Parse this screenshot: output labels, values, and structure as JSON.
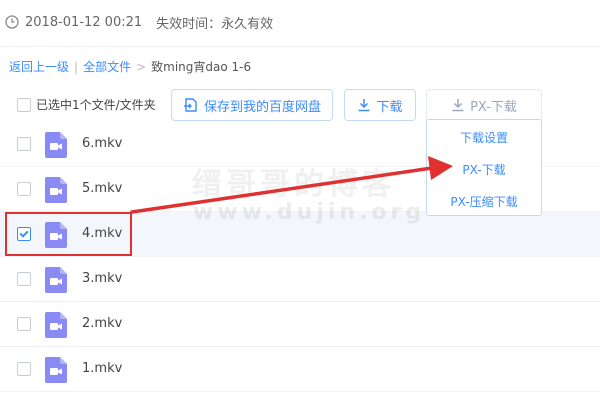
{
  "info": {
    "date": "2018-01-12 00:21",
    "expire_label": "失效时间：永久有效"
  },
  "breadcrumb": {
    "back": "返回上一级",
    "sep1": "|",
    "all_files": "全部文件",
    "sep2": ">",
    "current": "致ming宵dao 1-6"
  },
  "toolbar": {
    "selected_text": "已选中1个文件/文件夹",
    "save_label": "保存到我的百度网盘",
    "download_label": "下载",
    "px_label": "PX-下载"
  },
  "dropdown": {
    "items": [
      "下载设置",
      "PX-下载",
      "PX-压缩下载"
    ]
  },
  "files": [
    {
      "name": "6.mkv",
      "checked": false
    },
    {
      "name": "5.mkv",
      "checked": false
    },
    {
      "name": "4.mkv",
      "checked": true
    },
    {
      "name": "3.mkv",
      "checked": false
    },
    {
      "name": "2.mkv",
      "checked": false
    },
    {
      "name": "1.mkv",
      "checked": false
    }
  ],
  "watermark": {
    "title": "缙哥哥的博客",
    "url": "www.dujin.org"
  },
  "colors": {
    "accent": "#3b8cff",
    "file_icon": "#8a8af5",
    "highlight": "#e03030",
    "selected_row": "#f3f7fc"
  }
}
